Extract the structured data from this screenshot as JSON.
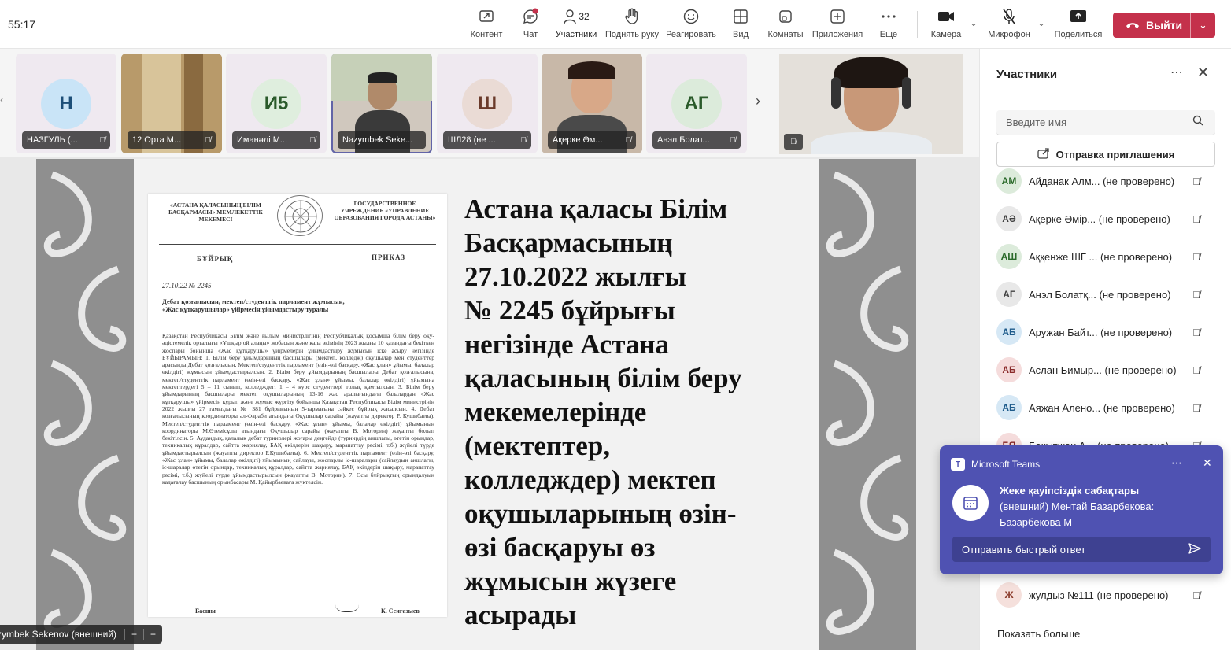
{
  "timer": "55:17",
  "toolbar": {
    "items": [
      {
        "label": "Контент",
        "icon": "share-screen-icon"
      },
      {
        "label": "Чат",
        "icon": "chat-icon"
      },
      {
        "label": "Участники",
        "icon": "people-icon",
        "count": "32"
      },
      {
        "label": "Поднять руку",
        "icon": "raise-hand-icon"
      },
      {
        "label": "Реагировать",
        "icon": "emoji-icon"
      },
      {
        "label": "Вид",
        "icon": "grid-view-icon"
      },
      {
        "label": "Комнаты",
        "icon": "breakout-rooms-icon"
      },
      {
        "label": "Приложения",
        "icon": "add-apps-icon"
      },
      {
        "label": "Еще",
        "icon": "more-icon"
      }
    ],
    "camera": "Камера",
    "mic": "Микрофон",
    "share": "Поделиться",
    "leave": "Выйти"
  },
  "video_tiles": [
    {
      "initials": "Н",
      "name": "НАЗГУЛЬ (...",
      "color": "#c9e4f7"
    },
    {
      "initials": "",
      "name": "12 Орта М...",
      "color": "#c8a878"
    },
    {
      "initials": "И5",
      "name": "Иманәлі М...",
      "color": "#dfeede"
    },
    {
      "initials": "",
      "name": "Nazymbek Seke...",
      "color": "#d8d0c8"
    },
    {
      "initials": "Ш",
      "name": "ШЛ28 (не ...",
      "color": "#eadbd5"
    },
    {
      "initials": "",
      "name": "Ақерке Әм...",
      "color": "#b8a898"
    },
    {
      "initials": "АГ",
      "name": "Анэл Болат...",
      "color": "#dcebdb"
    }
  ],
  "slide": {
    "doc": {
      "header_left": "«АСТАНА ҚАЛАСЫНЫҢ БІЛІМ БАСҚАРМАСЫ» МЕМЛЕКЕТТІК МЕКЕМЕСІ",
      "header_right": "ГОСУДАРСТВЕННОЕ УЧРЕЖДЕНИЕ «УПРАВЛЕНИЕ ОБРАЗОВАНИЯ ГОРОДА АСТАНЫ»",
      "label_kz": "БҰЙРЫҚ",
      "label_ru": "ПРИКАЗ",
      "date": "27.10.22 № 2245",
      "subject": "Дебат қозғалысын, мектеп/студенттік парламент жұмысын, «Жас құтқарушылар» үйірмесін ұйымдастыру туралы",
      "body": "Қазақстан Республикасы Білім және ғылым министрлігінің Республикалық қосымша білім беру оқу-әдістемелік орталығы «Ұшқыр ой алаңы» жобасын және қала әкімінің 2023 жылғы 10 қазандағы бекіткен жоспары бойынша «Жас құтқарушы» үйірмелерін ұйымдастыру жұмысын іске асыру негізінде БҰЙЫРАМЫН: 1. Білім беру ұйымдарының басшылары (мектеп, колледж) оқушылар мен студенттер арасында Дебат қозғалысын, Мектеп/студенттік парламент (өзін-өзі басқару, «Жас ұлан» ұйымы, балалар өкілдігі) жұмысын ұйымдастырылсын. 2. Білім беру ұйымдарының басшылары Дебат қозғалысына, мектеп/студенттік парламент (өзін-өзі басқару, «Жас ұлан» ұйымы, балалар өкілдігі) ұйымына мектептердегі 5 – 11 сынып, колледждегі 1 – 4 курс студенттері толық қамтылсын. 3. Білім беру ұйымдарының басшылары мектеп оқушыларының 13-16 жас аралығындағы балалардан «Жас құтқарушы» үйірмесін құрып және жұмыс жүргізу бойынша Қазақстан Республикасы Білім министрінің 2022 жылғы 27 тамыздағы № 381 бұйрығының 5-тармағына сәйкес бұйрық жасалсын. 4. Дебат қозғалысының координаторы әл-Фараби атындағы Оқушылар сарайы (жауапты директор Р. Кушибаева). Мектеп/студенттік парламент (өзін-өзі басқару, «Жас ұлан» ұйымы, балалар өкілдігі) ұйымының координаторы М.Өтемісұлы атындағы Оқушылар сарайы (жауапты В. Моторин) жауапты болып бекітілсін. 5. Аудандық, қалалық дебат турнирлері жоғары деңгейде (турнирдің аншлагы, өтетін орындар, техникалық құралдар, сайтта жариялау, БАҚ өкілдерін шақыру, марапаттау рәсімі, т.б.) жүйелі түрде ұйымдастырылсын (жауапты директор Р.Кушибаева). 6. Мектеп/студенттік парламент (өзін-өзі басқару, «Жас ұлан» ұйымы, балалар өкілдігі) ұйымының сайлауы, жоспарлы іс-шаралары (сайлаудың аншлагы, іс-шаралар өтетін орындар, техникалық құралдар, сайтта жариялау, БАҚ өкілдерін шақыру, марапаттау рәсімі, т.б.) жүйелі түрде ұйымдастырылсын (жауапты В. Моторин). 7. Осы бұйрықтың орындалуын қадағалау басшының орынбасары М. Қайырбаеваға жүктелсін.",
      "sign_left": "Басшы",
      "sign_right": "К. Сенгазыев"
    },
    "heading": "Астана қаласы Білім\nБасқармасының\n27.10.2022 жылғы\n№ 2245 бұйрығы\nнегізінде Астана\nқаласының білім беру\nмекемелерінде\n(мектептер,\nколледждер) мектеп\nоқушыларының өзін-\nөзі басқаруы өз\nжұмысын жүзеге\nасырады"
  },
  "presenter": {
    "name": "zymbek Sekenov (внешний)"
  },
  "panel": {
    "title": "Участники",
    "search_placeholder": "Введите имя",
    "invite": "Отправка приглашения",
    "participants": [
      {
        "initials": "АМ",
        "name": "Айданак Алм... (не проверено)",
        "color": "#dcebdb",
        "fg": "#2a6a2a"
      },
      {
        "initials": "АӘ",
        "name": "Ақерке Әмір... (не проверено)",
        "color": "#e8e8e8",
        "fg": "#424242"
      },
      {
        "initials": "АШ",
        "name": "Аққенже ШГ ... (не проверено)",
        "color": "#dcebdb",
        "fg": "#2a6a2a"
      },
      {
        "initials": "АГ",
        "name": "Анэл Болатқ... (не проверено)",
        "color": "#e8e8e8",
        "fg": "#424242"
      },
      {
        "initials": "АБ",
        "name": "Аружан Байт... (не проверено)",
        "color": "#d6e8f5",
        "fg": "#1d5a8a"
      },
      {
        "initials": "АБ",
        "name": "Аслан Бимыр... (не проверено)",
        "color": "#f5dcdc",
        "fg": "#8a2a2a"
      },
      {
        "initials": "АБ",
        "name": "Аяжан Алено... (не проверено)",
        "color": "#d6e8f5",
        "fg": "#1d5a8a"
      },
      {
        "initials": "БЯ",
        "name": "Бакытжан А... (не проверено)",
        "color": "#f5dcdc",
        "fg": "#8a2a2a"
      }
    ],
    "last_participant": {
      "initials": "Ж",
      "name": "жулдыз №111 (не проверено)",
      "color": "#f5e0dc",
      "fg": "#8a3a2a"
    },
    "show_more": "Показать больше"
  },
  "toast": {
    "app": "Microsoft Teams",
    "title": "Жеке қауіпсіздік сабақтары",
    "line2": "(внешний) Ментай Базарбекова:",
    "line3": "Базарбекова М",
    "reply": "Отправить быстрый ответ"
  }
}
